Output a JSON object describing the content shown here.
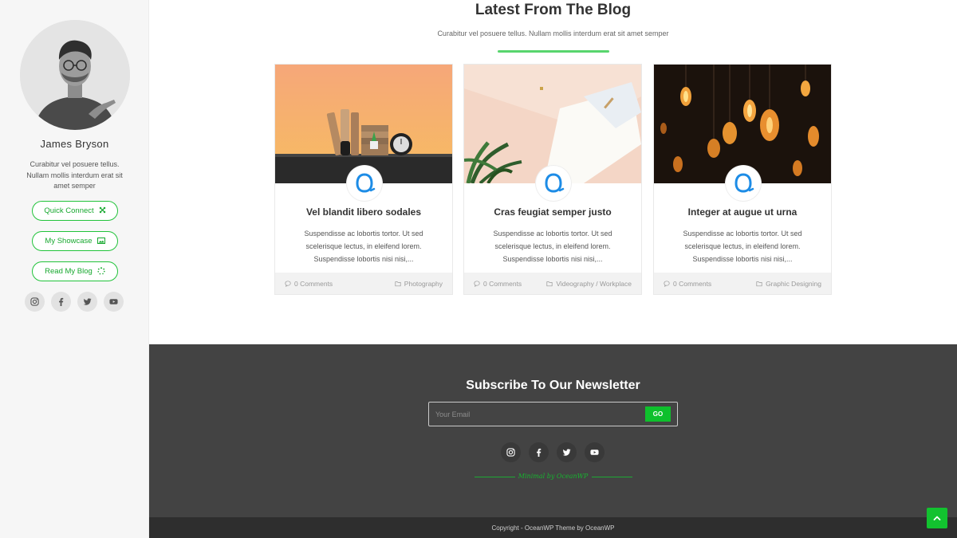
{
  "profile": {
    "name": "James Bryson",
    "bio": "Curabitur vel posuere tellus. Nullam mollis interdum erat sit amet semper",
    "buttons": [
      {
        "label": "Quick Connect",
        "icon": "arrows-expand-icon"
      },
      {
        "label": "My Showcase",
        "icon": "image-icon"
      },
      {
        "label": "Read My Blog",
        "icon": "spinner-icon"
      }
    ],
    "social": [
      "instagram-icon",
      "facebook-icon",
      "twitter-icon",
      "youtube-icon"
    ]
  },
  "blog": {
    "title": "Latest From The Blog",
    "subtitle": "Curabitur vel posuere tellus. Nullam mollis interdum erat sit amet semper",
    "posts": [
      {
        "title": "Vel blandit libero sodales",
        "excerpt": "Suspendisse ac lobortis tortor. Ut sed scelerisque lectus, in eleifend lorem. Suspendisse lobortis nisi nisi,...",
        "comments": "0 Comments",
        "category": "Photography"
      },
      {
        "title": "Cras feugiat semper justo",
        "excerpt": "Suspendisse ac lobortis tortor. Ut sed scelerisque lectus, in eleifend lorem. Suspendisse lobortis nisi nisi,...",
        "comments": "0 Comments",
        "category": "Videography / Workplace"
      },
      {
        "title": "Integer at augue ut urna",
        "excerpt": "Suspendisse ac lobortis tortor. Ut sed scelerisque lectus, in eleifend lorem. Suspendisse lobortis nisi nisi,...",
        "comments": "0 Comments",
        "category": "Graphic Designing"
      }
    ]
  },
  "newsletter": {
    "title": "Subscribe To Our Newsletter",
    "placeholder": "Your Email",
    "button": "GO",
    "social": [
      "instagram-icon",
      "facebook-icon",
      "twitter-icon",
      "youtube-icon"
    ],
    "tagline": "Minimal by OceanWP"
  },
  "footer": {
    "copyright": "Copyright - OceanWP Theme by OceanWP"
  },
  "colors": {
    "accent": "#21c33a",
    "footer_bg": "#434343",
    "copyright_bg": "#2e2e2e",
    "sidebar_bg": "#f6f6f6"
  }
}
